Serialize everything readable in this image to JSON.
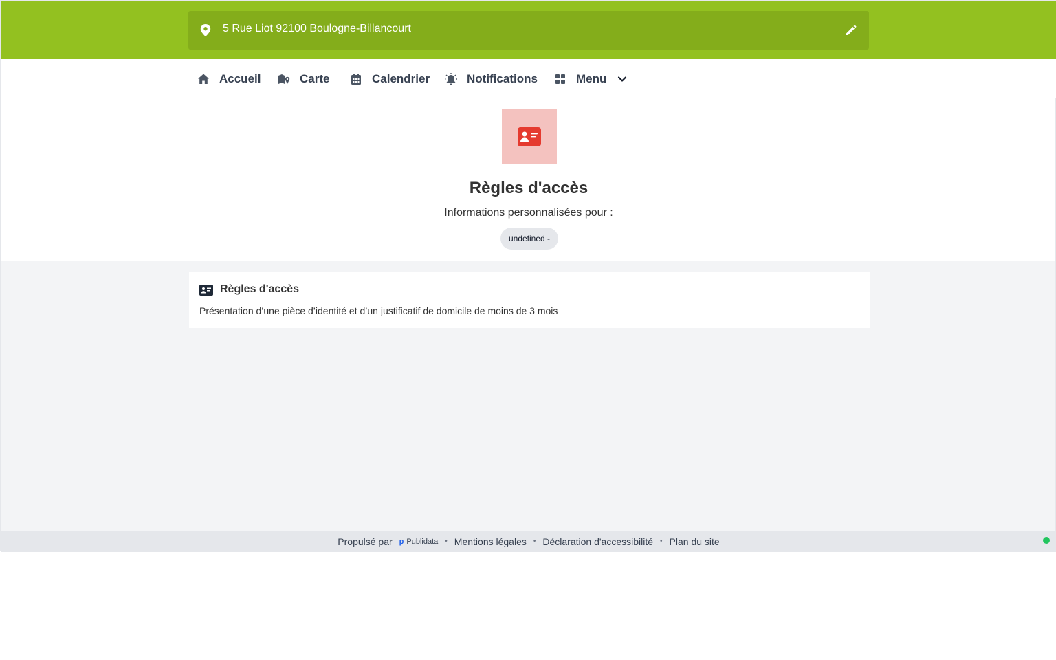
{
  "header": {
    "address": "5 Rue Liot 92100 Boulogne-Billancourt",
    "brand_color": "#93c120",
    "icons": {
      "location": "map-pin-icon",
      "edit": "pencil-icon"
    }
  },
  "nav": {
    "items": [
      {
        "label": "Accueil",
        "icon": "home-icon"
      },
      {
        "label": "Carte",
        "icon": "map-icon"
      },
      {
        "label": "Calendrier",
        "icon": "calendar-icon"
      },
      {
        "label": "Notifications",
        "icon": "bell-alert-icon"
      },
      {
        "label": "Menu",
        "icon": "grid-icon",
        "has_dropdown": true
      }
    ]
  },
  "hero": {
    "icon": "id-card-icon",
    "icon_color": "#e53a2f",
    "icon_bg": "#f4c2bf",
    "title": "Règles d'accès",
    "subtitle": "Informations personnalisées pour :",
    "chip": "undefined -"
  },
  "card": {
    "icon": "id-card-icon",
    "title": "Règles d'accès",
    "text": "Présentation d’une pièce d’identité et d’un justificatif de domicile de moins de 3 mois"
  },
  "footer": {
    "powered_by": "Propulsé par",
    "brand": "Publidata",
    "links": [
      "Mentions légales",
      "Déclaration d'accessibilité",
      "Plan du site"
    ],
    "separator": "•",
    "status_color": "#22c55e"
  }
}
